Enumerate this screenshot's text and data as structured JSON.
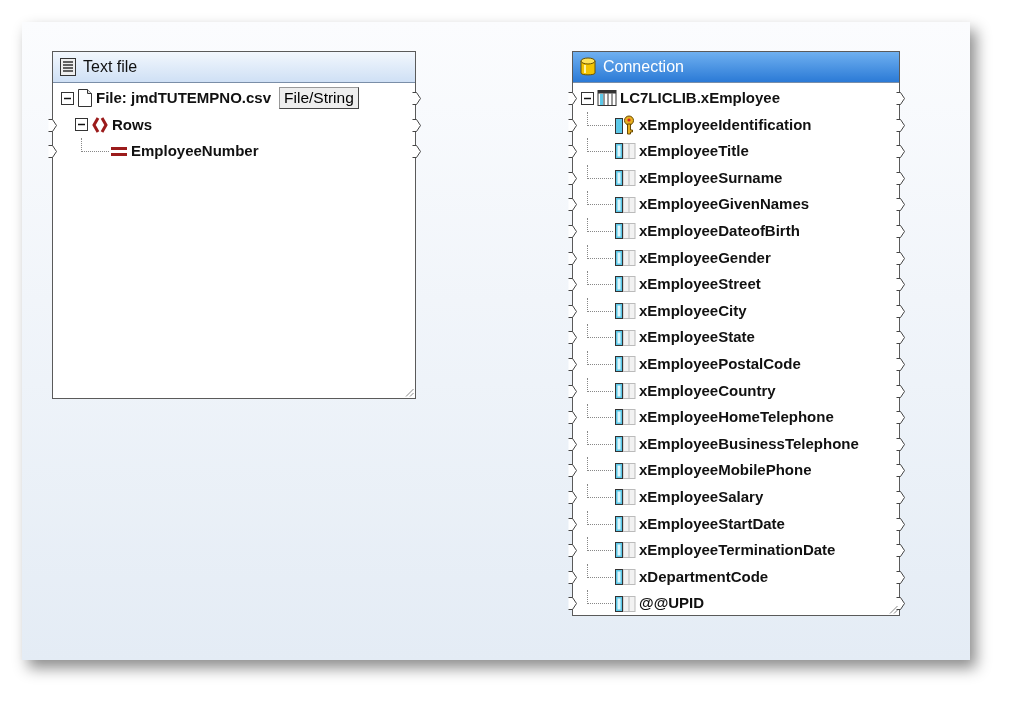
{
  "components": [
    {
      "kind": "text",
      "title": "Text file",
      "nodes": [
        {
          "label": "File: jmdTUTEMPNO.csv",
          "kind": "file",
          "input": false,
          "button": "File/String",
          "expanded": true,
          "children": [
            {
              "label": "Rows",
              "kind": "rows",
              "input": true,
              "expanded": true,
              "children": [
                {
                  "label": "EmployeeNumber",
                  "kind": "field",
                  "input": true
                }
              ]
            }
          ]
        }
      ]
    },
    {
      "kind": "db",
      "title": "Connection",
      "nodes": [
        {
          "label": "LC7LICLIB.xEmployee",
          "kind": "table",
          "input": true,
          "expanded": true,
          "children": [
            {
              "label": "xEmployeeIdentification",
              "kind": "key",
              "input": true
            },
            {
              "label": "xEmployeeTitle",
              "kind": "column",
              "input": true
            },
            {
              "label": "xEmployeeSurname",
              "kind": "column",
              "input": true
            },
            {
              "label": "xEmployeeGivenNames",
              "kind": "column",
              "input": true
            },
            {
              "label": "xEmployeeDateofBirth",
              "kind": "column",
              "input": true
            },
            {
              "label": "xEmployeeGender",
              "kind": "column",
              "input": true
            },
            {
              "label": "xEmployeeStreet",
              "kind": "column",
              "input": true
            },
            {
              "label": "xEmployeeCity",
              "kind": "column",
              "input": true
            },
            {
              "label": "xEmployeeState",
              "kind": "column",
              "input": true
            },
            {
              "label": "xEmployeePostalCode",
              "kind": "column",
              "input": true
            },
            {
              "label": "xEmployeeCountry",
              "kind": "column",
              "input": true
            },
            {
              "label": "xEmployeeHomeTelephone",
              "kind": "column",
              "input": true
            },
            {
              "label": "xEmployeeBusinessTelephone",
              "kind": "column",
              "input": true
            },
            {
              "label": "xEmployeeMobilePhone",
              "kind": "column",
              "input": true
            },
            {
              "label": "xEmployeeSalary",
              "kind": "column",
              "input": true
            },
            {
              "label": "xEmployeeStartDate",
              "kind": "column",
              "input": true
            },
            {
              "label": "xEmployeeTerminationDate",
              "kind": "column",
              "input": true
            },
            {
              "label": "xDepartmentCode",
              "kind": "column",
              "input": true
            },
            {
              "label": "@@UPID",
              "kind": "column",
              "input": true
            }
          ]
        }
      ]
    }
  ]
}
